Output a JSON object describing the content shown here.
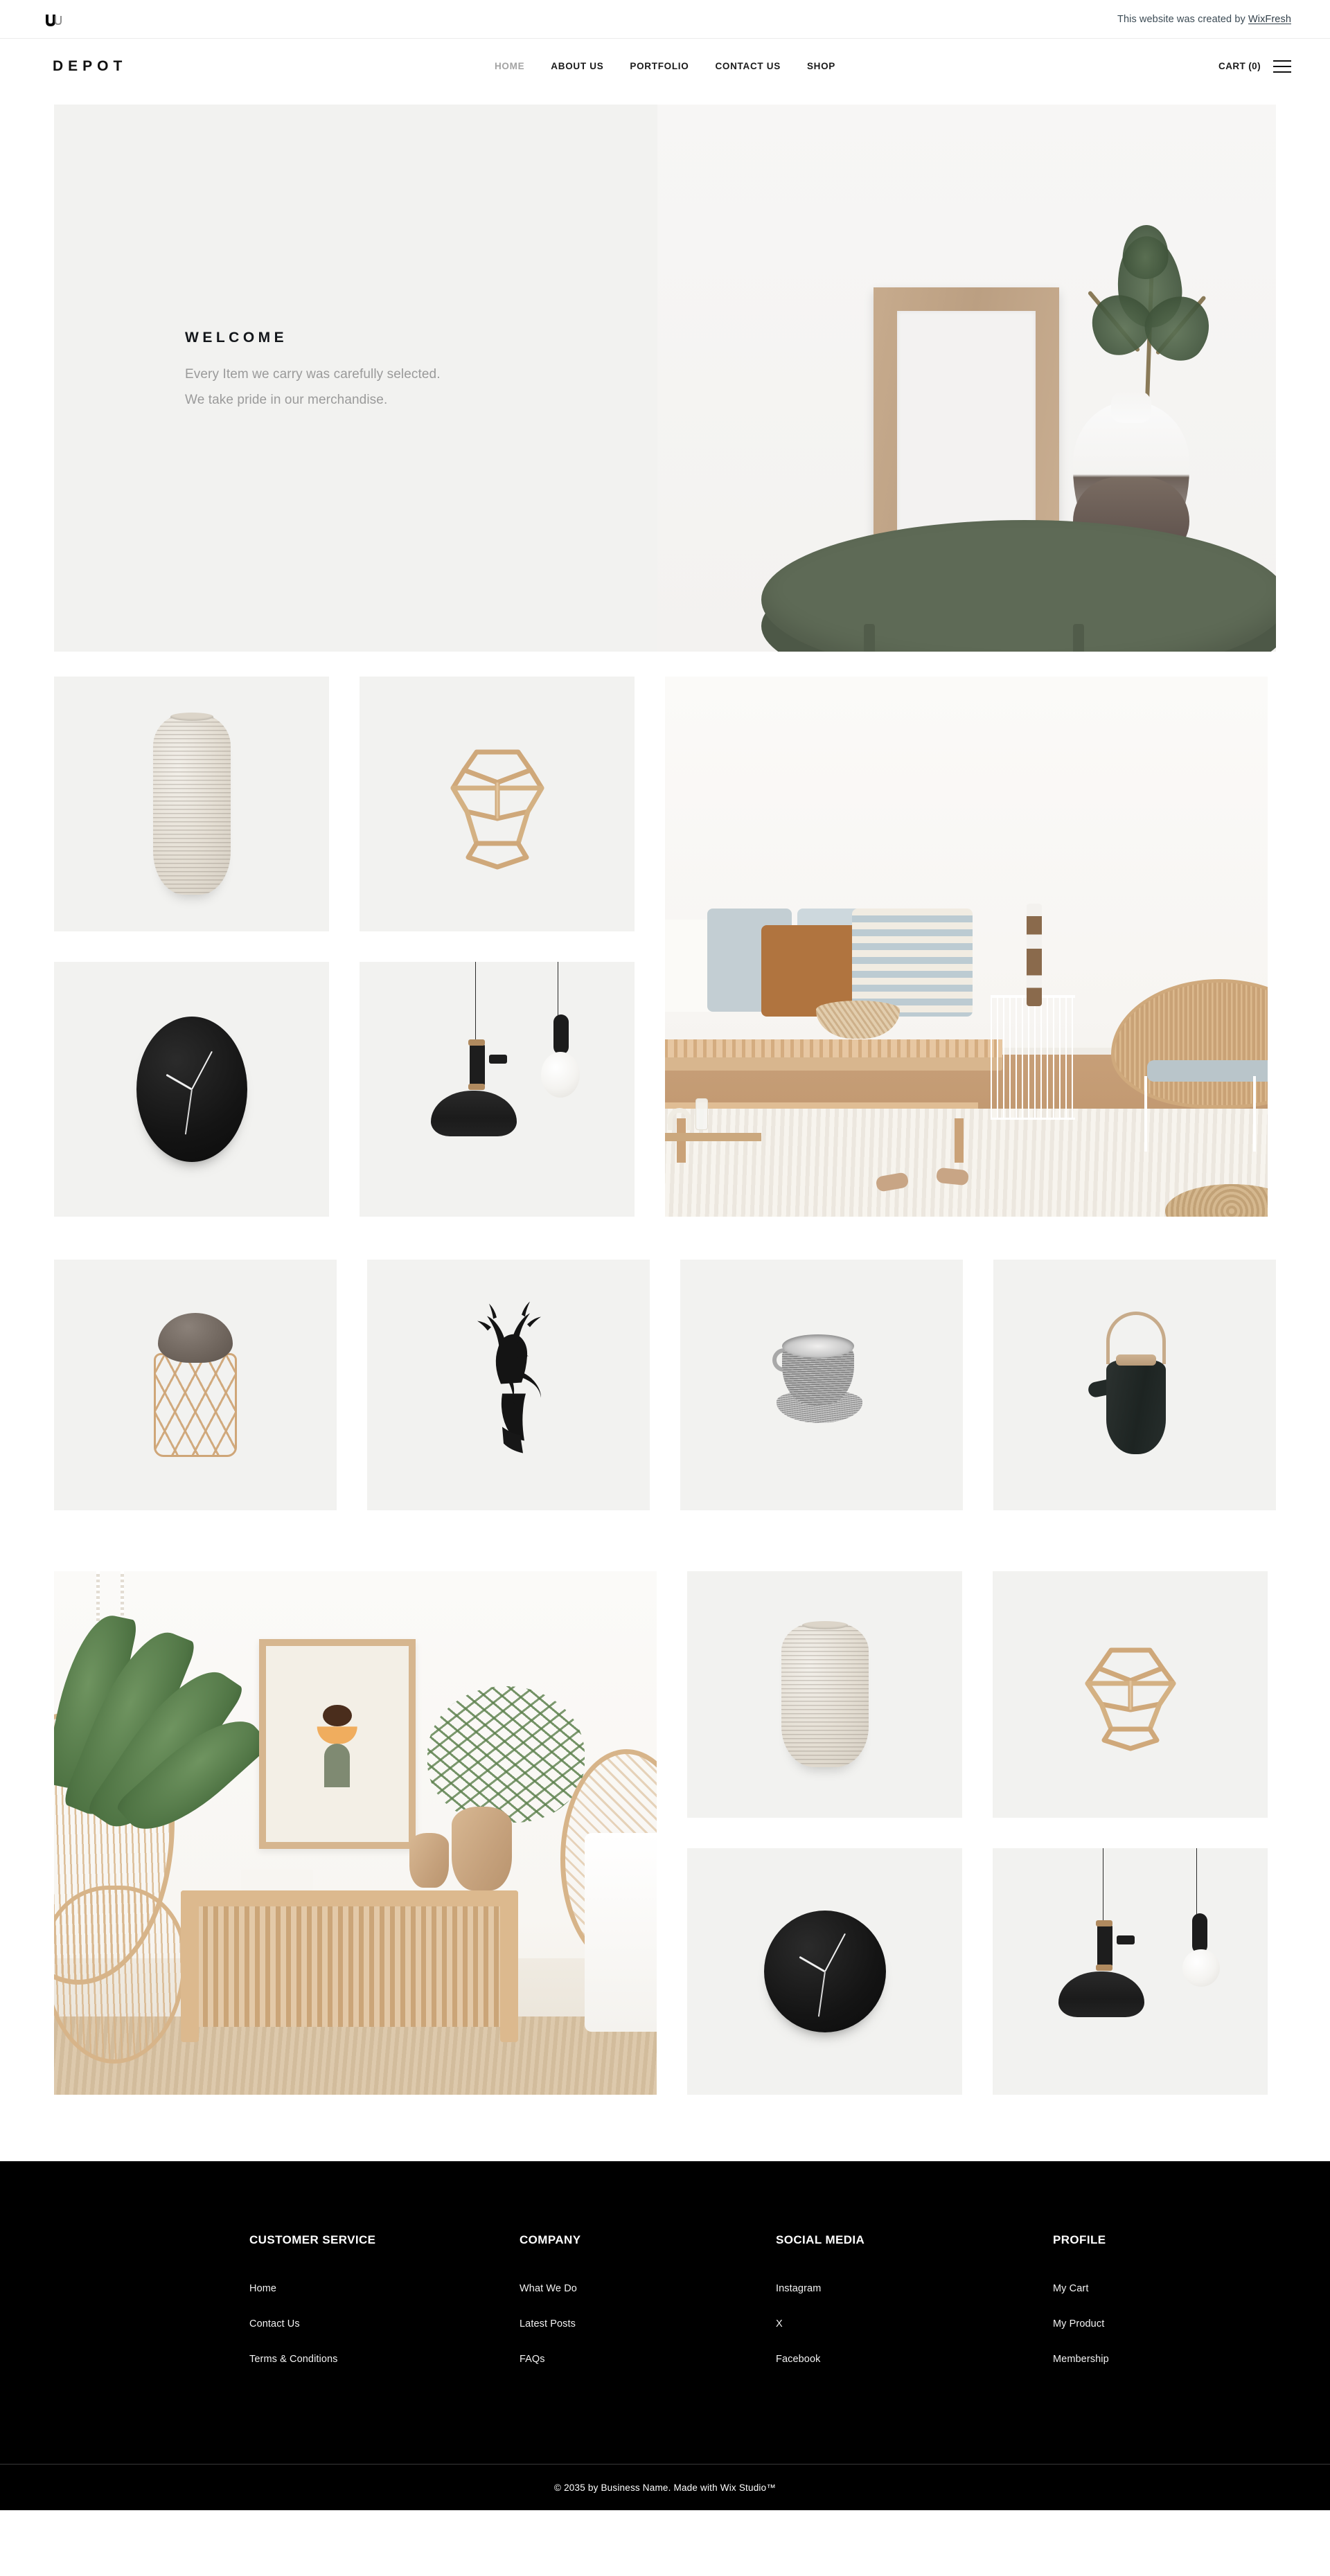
{
  "wix_banner": {
    "logo_icon": "wix-logo-icon",
    "text_prefix": "This website was created by ",
    "link_label": "WixFresh"
  },
  "header": {
    "brand": "DEPOT",
    "nav": [
      {
        "label": "HOME",
        "active": true
      },
      {
        "label": "ABOUT US",
        "active": false
      },
      {
        "label": "PORTFOLIO",
        "active": false
      },
      {
        "label": "CONTACT US",
        "active": false
      },
      {
        "label": "SHOP",
        "active": false
      }
    ],
    "cart_label": "CART (0)",
    "menu_icon": "hamburger-menu-icon"
  },
  "hero": {
    "title": "WELCOME",
    "line1": "Every Item we carry was carefully selected.",
    "line2": "We take pride in our merchandise.",
    "image_alt": "Wooden picture frame and two-tone vase with pine branch on a green round side table"
  },
  "gallery": {
    "section_a": [
      {
        "name": "ribbed-ceramic-vase",
        "alt": "Tall ribbed speckled ceramic vase"
      },
      {
        "name": "gold-geometric-lantern",
        "alt": "Gold geometric dodecahedron glass terrarium"
      },
      {
        "name": "living-room-scene",
        "alt": "Living room with wooden bench, cushions, rattan chair and wire side table"
      },
      {
        "name": "black-wall-clock",
        "alt": "Black minimalist oval wall clock with white hands"
      },
      {
        "name": "black-pendant-lamps",
        "alt": "Two black pendant lamps, one cone shade and one globe bulb"
      }
    ],
    "section_b": [
      {
        "name": "rattan-stool",
        "alt": "Round stool with leather top and woven rattan base"
      },
      {
        "name": "deer-head-sculpture",
        "alt": "Black matte deer head sculpture with antlers"
      },
      {
        "name": "ceramic-cup-saucer",
        "alt": "Textured grey ceramic cup and saucer"
      },
      {
        "name": "black-kettle",
        "alt": "Black kettle with leather handle and wooden lid"
      }
    ],
    "section_c": [
      {
        "name": "bedroom-scene",
        "alt": "Bedroom with hanging rattan chair, slatted console, framed abstract art and plants"
      },
      {
        "name": "ribbed-ceramic-vase",
        "alt": "Ribbed speckled ceramic vase"
      },
      {
        "name": "gold-geometric-lantern",
        "alt": "Gold geometric dodecahedron glass terrarium"
      },
      {
        "name": "black-wall-clock",
        "alt": "Black minimalist round wall clock"
      },
      {
        "name": "black-pendant-lamps",
        "alt": "Two black pendant lamps"
      }
    ]
  },
  "footer": {
    "columns": [
      {
        "title": "CUSTOMER SERVICE",
        "links": [
          "Home",
          "Contact Us",
          "Terms & Conditions"
        ]
      },
      {
        "title": "COMPANY",
        "links": [
          "What We Do",
          "Latest Posts",
          "FAQs"
        ]
      },
      {
        "title": "SOCIAL MEDIA",
        "links": [
          "Instagram",
          "X",
          "Facebook"
        ]
      },
      {
        "title": "PROFILE",
        "links": [
          "My Cart",
          "My Product",
          "Membership"
        ]
      }
    ],
    "copyright": "© 2035 by Business Name. Made with Wix Studio™"
  },
  "colors": {
    "tile_bg": "#f2f2f0",
    "footer_bg": "#000000",
    "nav_active": "#a3a3a3",
    "text_dark": "#111111",
    "hero_sub": "#9a9a9a"
  }
}
